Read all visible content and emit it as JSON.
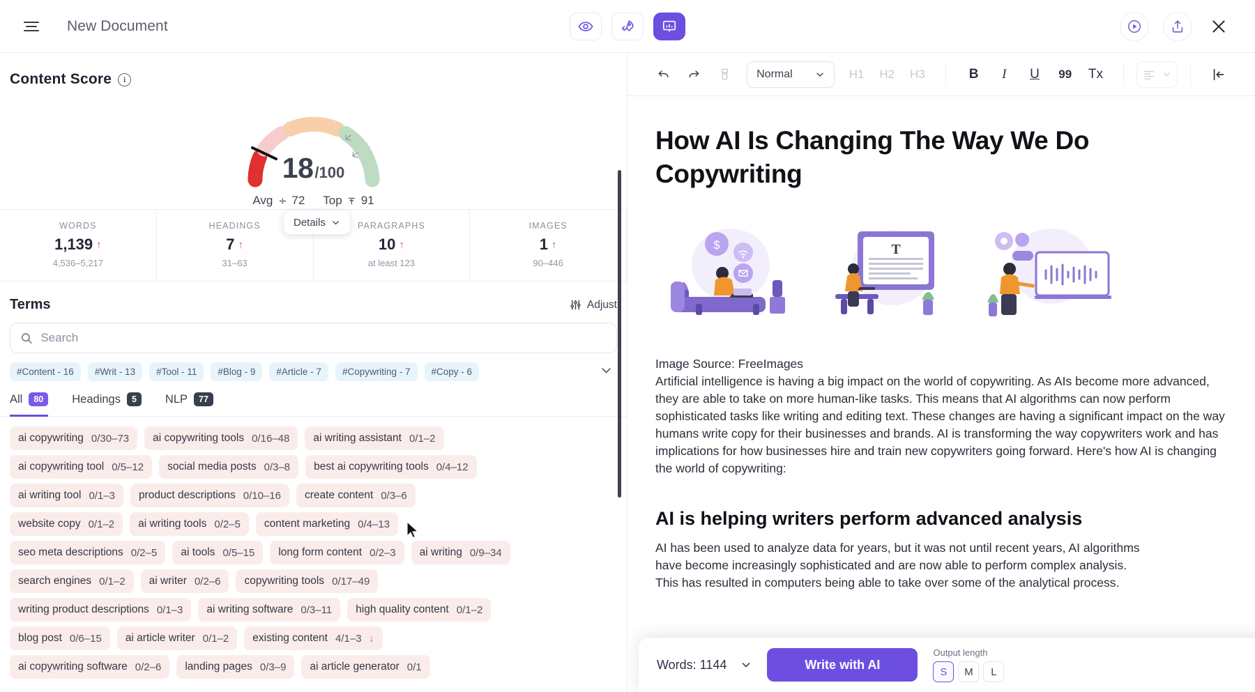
{
  "topbar": {
    "menu_icon": "hamburger-icon",
    "document_title": "New Document",
    "center_buttons": [
      {
        "name": "preview-eye-icon",
        "label": "Preview"
      },
      {
        "name": "rocket-icon",
        "label": "Optimize"
      },
      {
        "name": "presentation-icon",
        "label": "Brief"
      }
    ],
    "right_buttons": [
      {
        "name": "play-circle-icon",
        "label": "Play"
      },
      {
        "name": "share-upload-icon",
        "label": "Share"
      },
      {
        "name": "close-icon",
        "label": "Close"
      }
    ]
  },
  "content_score": {
    "title": "Content Score",
    "info_icon": "info-icon",
    "score": "18",
    "score_denominator": "/100",
    "avg_label": "Avg",
    "avg_value": "72",
    "top_label": "Top",
    "top_value": "91",
    "gauge": {
      "value": 18,
      "max": 100,
      "segments": [
        {
          "color": "#e03030",
          "from": 0,
          "to": 18
        },
        {
          "color": "#f6cccc",
          "from": 18,
          "to": 33
        },
        {
          "color": "#f7d0ab",
          "from": 33,
          "to": 62
        },
        {
          "color": "#bedcc2",
          "from": 62,
          "to": 100
        }
      ]
    },
    "details_label": "Details",
    "stats": [
      {
        "label": "WORDS",
        "value": "1,139",
        "trend": "↑",
        "range": "4,536–5,217"
      },
      {
        "label": "HEADINGS",
        "value": "7",
        "trend": "↑",
        "range": "31–63"
      },
      {
        "label": "PARAGRAPHS",
        "value": "10",
        "trend": "↑",
        "range": "at least 123"
      },
      {
        "label": "IMAGES",
        "value": "1",
        "trend": "↑",
        "range": "90–446"
      }
    ]
  },
  "terms": {
    "title": "Terms",
    "adjust_label": "Adjust",
    "adjust_icon": "sliders-icon",
    "search_placeholder": "Search",
    "search_value": "",
    "search_icon": "search-icon",
    "hashtags": [
      "#Content - 16",
      "#Writ - 13",
      "#Tool - 11",
      "#Blog - 9",
      "#Article - 7",
      "#Copywriting - 7",
      "#Copy - 6"
    ],
    "expand_icon": "chevron-down-icon",
    "tabs": [
      {
        "label": "All",
        "count": "80",
        "active": true,
        "badge_style": "purple"
      },
      {
        "label": "Headings",
        "count": "5",
        "active": false,
        "badge_style": "dark"
      },
      {
        "label": "NLP",
        "count": "77",
        "active": false,
        "badge_style": "dark"
      }
    ],
    "rows": [
      [
        {
          "term": "ai copywriting",
          "count": "0/30–73"
        },
        {
          "term": "ai copywriting tools",
          "count": "0/16–48"
        },
        {
          "term": "ai writing assistant",
          "count": "0/1–2"
        }
      ],
      [
        {
          "term": "ai copywriting tool",
          "count": "0/5–12"
        },
        {
          "term": "social media posts",
          "count": "0/3–8"
        },
        {
          "term": "best ai copywriting tools",
          "count": "0/4–12"
        }
      ],
      [
        {
          "term": "ai writing tool",
          "count": "0/1–3"
        },
        {
          "term": "product descriptions",
          "count": "0/10–16"
        },
        {
          "term": "create content",
          "count": "0/3–6"
        }
      ],
      [
        {
          "term": "website copy",
          "count": "0/1–2"
        },
        {
          "term": "ai writing tools",
          "count": "0/2–5"
        },
        {
          "term": "content marketing",
          "count": "0/4–13"
        }
      ],
      [
        {
          "term": "seo meta descriptions",
          "count": "0/2–5"
        },
        {
          "term": "ai tools",
          "count": "0/5–15"
        },
        {
          "term": "long form content",
          "count": "0/2–3"
        },
        {
          "term": "ai writing",
          "count": "0/9–34"
        }
      ],
      [
        {
          "term": "search engines",
          "count": "0/1–2"
        },
        {
          "term": "ai writer",
          "count": "0/2–6"
        },
        {
          "term": "copywriting tools",
          "count": "0/17–49"
        }
      ],
      [
        {
          "term": "writing product descriptions",
          "count": "0/1–3"
        },
        {
          "term": "ai writing software",
          "count": "0/3–11"
        },
        {
          "term": "high quality content",
          "count": "0/1–2"
        }
      ],
      [
        {
          "term": "blog post",
          "count": "0/6–15"
        },
        {
          "term": "ai article writer",
          "count": "0/1–2"
        },
        {
          "term": "existing content",
          "count": "4/1–3",
          "down": "↓"
        }
      ],
      [
        {
          "term": "ai copywriting software",
          "count": "0/2–6"
        },
        {
          "term": "landing pages",
          "count": "0/3–9"
        },
        {
          "term": "ai article generator",
          "count": "0/1"
        }
      ]
    ]
  },
  "editor_toolbar": {
    "undo_icon": "undo-icon",
    "redo_icon": "redo-icon",
    "paint_icon": "clear-format-icon",
    "style_value": "Normal",
    "style_chevron": "chevron-down-icon",
    "headings": [
      "H1",
      "H2",
      "H3"
    ],
    "bold": "B",
    "italic": "I",
    "underline": "U",
    "quote": "99",
    "clear_format": "Tx",
    "align_icon": "align-left-icon",
    "align_chevron": "chevron-down-icon",
    "collapse_icon": "collapse-panel-icon"
  },
  "document": {
    "title": "How AI Is Changing The Way We Do Copywriting",
    "image_credit": "Image Source: FreeImages",
    "paragraph_1": "Artificial intelligence is having a big impact on the world of copywriting. As AIs become more advanced, they are able to take on more human-like tasks. This means that AI algorithms can now perform sophisticated tasks like writing and editing text. These changes are having a significant impact on the way humans write copy for their businesses and brands. AI is transforming the way copywriters work and has implications for how businesses hire and train new copywriters going forward. Here's how AI is changing the world of copywriting:",
    "heading_2": "AI is helping writers perform advanced analysis",
    "paragraph_2_line1": "AI has been used to analyze data for years, but it was not until recent years, AI algorithms",
    "paragraph_2_line2": "have become increasingly sophisticated and are now able to perform complex analysis.",
    "paragraph_2_line3": "This has resulted in computers being able to take over some of the analytical process."
  },
  "ai_bar": {
    "words_label": "Words: 1144",
    "words_chevron": "chevron-down-icon",
    "write_button": "Write with AI",
    "output_length_label": "Output length",
    "lengths": [
      {
        "label": "S",
        "selected": true
      },
      {
        "label": "M",
        "selected": false
      },
      {
        "label": "L",
        "selected": false
      }
    ]
  },
  "colors": {
    "accent": "#6c4fe0",
    "score_red": "#e03030",
    "term_bg": "#fbecec",
    "hashtag_bg": "#e8f4fb"
  }
}
